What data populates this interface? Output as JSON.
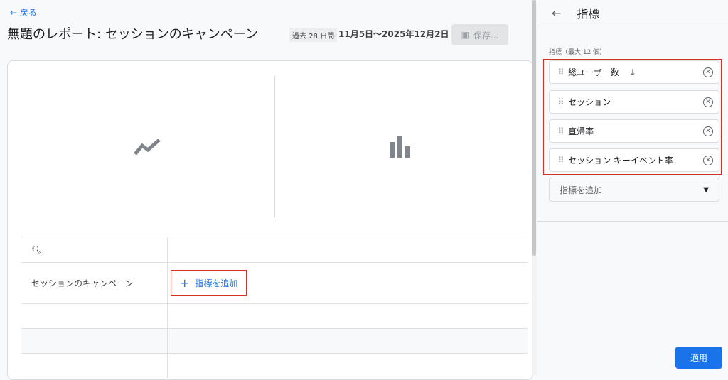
{
  "header": {
    "back_label": "← 戻る",
    "title": "無題のレポート: セッションのキャンペーン",
    "period_chip": "過去 28 日間",
    "date_range": "11月5日～2025年12月2日",
    "save_label": "保存..."
  },
  "table": {
    "search_icon": "search-icon",
    "dimension_label": "セッションのキャンペーン",
    "add_metric_label": "指標を追加"
  },
  "panel": {
    "title": "指標",
    "section_label": "指標（最大 12 個）",
    "metrics": [
      {
        "label": "総ユーザー数",
        "sorted": "↓"
      },
      {
        "label": "セッション"
      },
      {
        "label": "直帰率"
      },
      {
        "label": "セッション キーイベント率"
      }
    ],
    "add_placeholder": "指標を追加",
    "apply_label": "適用"
  },
  "colors": {
    "accent": "#1a73e8",
    "highlight": "#d93025"
  }
}
